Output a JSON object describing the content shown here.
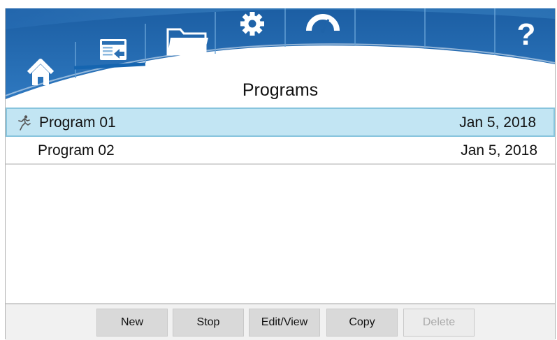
{
  "header": {
    "nav": [
      {
        "icon": "home-icon",
        "active": false
      },
      {
        "icon": "program-list-icon",
        "active": true
      },
      {
        "icon": "folder-icon",
        "active": false
      },
      {
        "icon": "gear-icon",
        "active": false
      },
      {
        "icon": "gauge-icon",
        "active": false
      },
      {
        "icon": "help-icon",
        "active": false
      }
    ],
    "help_glyph": "?",
    "colors": {
      "primary": "#1f63a8",
      "accent": "#3d87c4",
      "underline": "#1565b0"
    }
  },
  "page": {
    "title": "Programs"
  },
  "programs": [
    {
      "name": "Program 01",
      "date": "Jan 5, 2018",
      "running": true,
      "selected": true
    },
    {
      "name": "Program 02",
      "date": "Jan 5, 2018",
      "running": false,
      "selected": false
    }
  ],
  "toolbar": {
    "new_label": "New",
    "stop_label": "Stop",
    "edit_label": "Edit/View",
    "copy_label": "Copy",
    "delete_label": "Delete"
  },
  "colors": {
    "selected_row": "#c2e5f3",
    "selected_border": "#87c4dd"
  }
}
